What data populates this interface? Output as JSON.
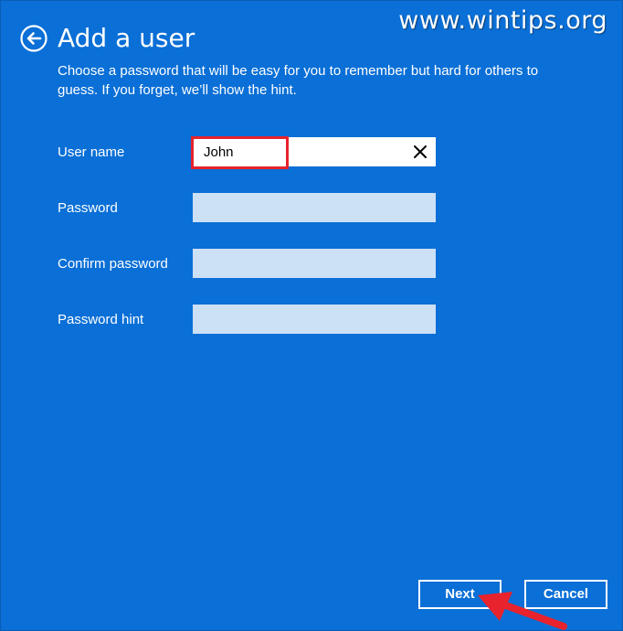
{
  "watermark": "www.wintips.org",
  "header": {
    "title": "Add a user",
    "subtitle": "Choose a password that will be easy for you to remember but hard for others to guess. If you forget, we’ll show the hint."
  },
  "form": {
    "username_label": "User name",
    "username_value": "John",
    "password_label": "Password",
    "password_value": "",
    "confirm_label": "Confirm password",
    "confirm_value": "",
    "hint_label": "Password hint",
    "hint_value": ""
  },
  "buttons": {
    "next": "Next",
    "cancel": "Cancel"
  },
  "icons": {
    "back": "back-arrow-icon",
    "clear": "close-icon",
    "annotation": "red-arrow-icon"
  },
  "colors": {
    "background": "#0a6fd6",
    "input_inactive": "#cce0f6",
    "highlight": "#e8232d"
  }
}
